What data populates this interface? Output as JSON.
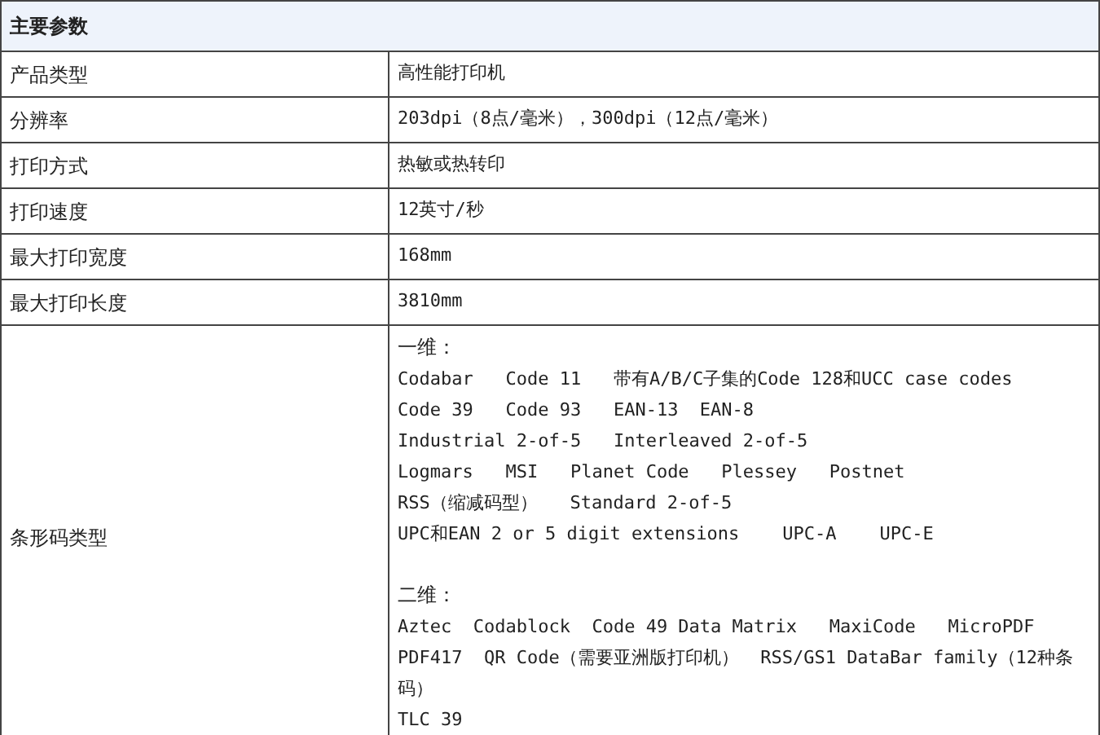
{
  "table": {
    "title": "主要参数",
    "rows": [
      {
        "label": "产品类型",
        "value": "高性能打印机"
      },
      {
        "label": "分辨率",
        "value": "203dpi（8点/毫米），300dpi（12点/毫米）"
      },
      {
        "label": "打印方式",
        "value": "热敏或热转印"
      },
      {
        "label": "打印速度",
        "value": "12英寸/秒"
      },
      {
        "label": "最大打印宽度",
        "value": "168mm"
      },
      {
        "label": "最大打印长度",
        "value": "3810mm"
      }
    ],
    "barcode_row": {
      "label": "条形码类型",
      "groups": [
        {
          "heading": "一维：",
          "lines": [
            "Codabar   Code 11   带有A/B/C子集的Code 128和UCC case codes",
            "Code 39   Code 93   EAN-13  EAN-8",
            "Industrial 2-of-5   Interleaved 2-of-5",
            "Logmars   MSI   Planet Code   Plessey   Postnet",
            "RSS（缩减码型）   Standard 2-of-5",
            "UPC和EAN 2 or 5 digit extensions    UPC-A    UPC-E"
          ]
        },
        {
          "heading": "二维：",
          "lines": [
            "Aztec  Codablock  Code 49 Data Matrix   MaxiCode   MicroPDF",
            "PDF417  QR Code（需要亚洲版打印机）  RSS/GS1 DataBar family（12种条码）",
            "TLC 39"
          ]
        }
      ]
    }
  }
}
